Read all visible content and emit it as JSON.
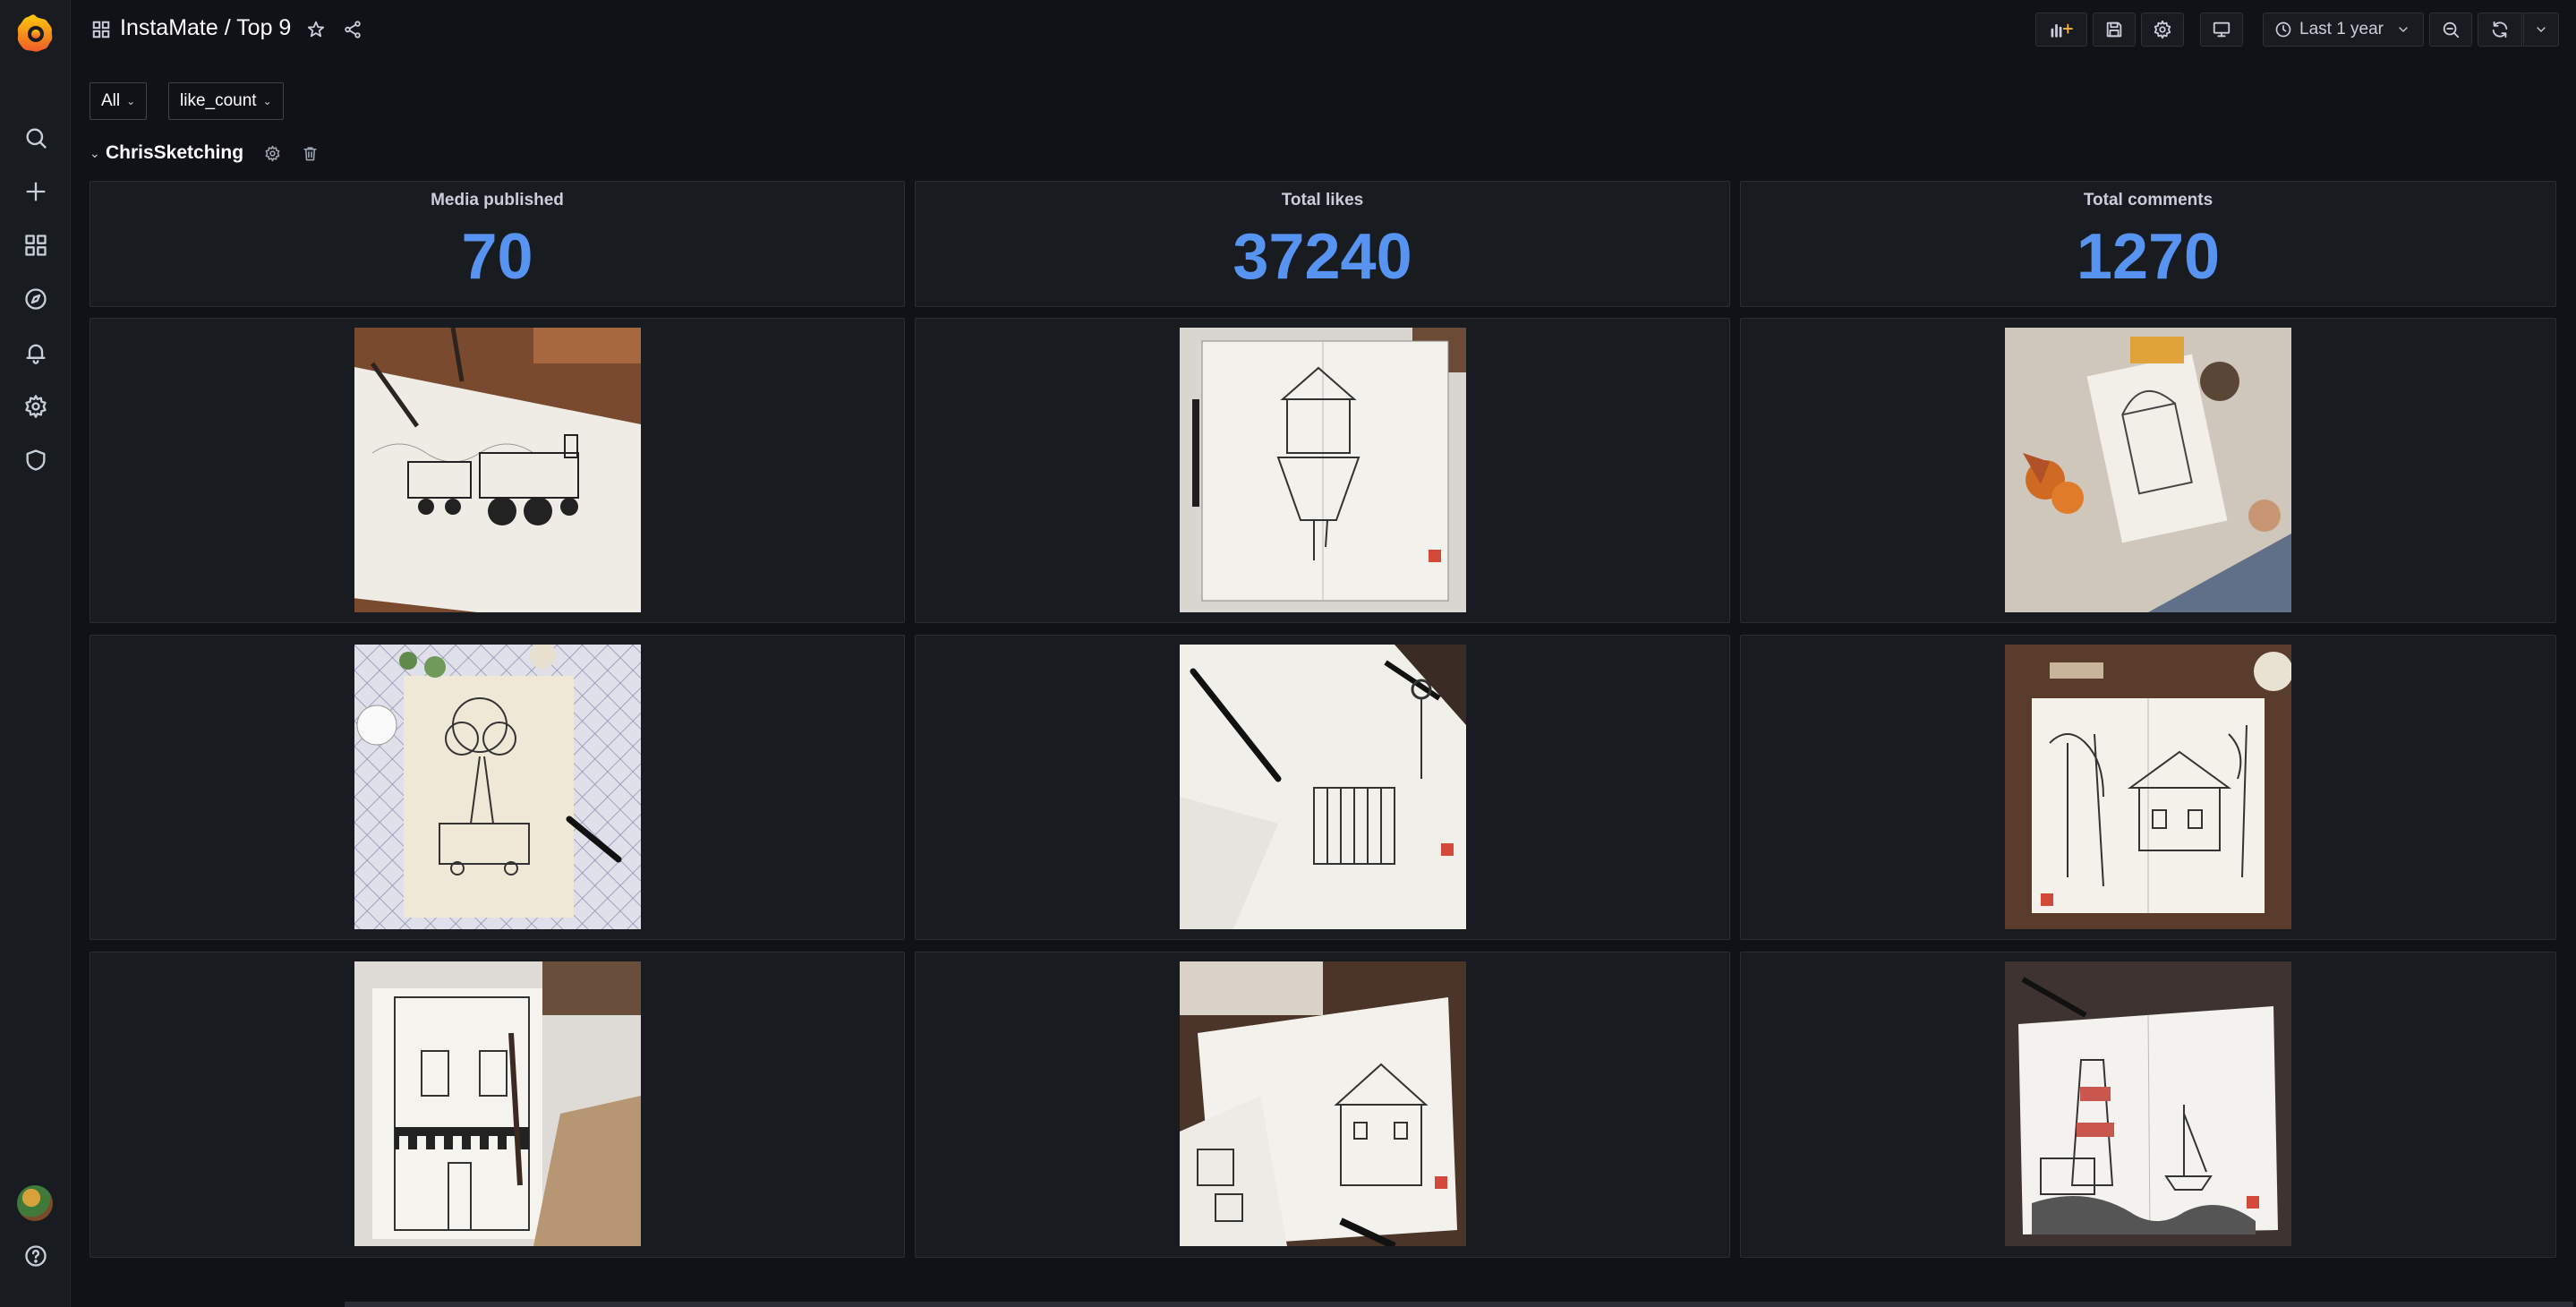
{
  "breadcrumb": {
    "folder": "InstaMate",
    "separator": " / ",
    "dashboard": "Top 9"
  },
  "toolbar": {
    "time_range": "Last 1 year"
  },
  "variables": [
    {
      "value": "All"
    },
    {
      "value": "like_count"
    }
  ],
  "row": {
    "title": "ChrisSketching"
  },
  "stats": [
    {
      "title": "Media published",
      "value": "70"
    },
    {
      "title": "Total likes",
      "value": "37240"
    },
    {
      "title": "Total comments",
      "value": "1270"
    }
  ],
  "posts": [
    {
      "icon": "sketch-train-image"
    },
    {
      "icon": "sketch-floating-house-image"
    },
    {
      "icon": "sketch-autumn-doorway-image"
    },
    {
      "icon": "sketch-balloon-bus-image"
    },
    {
      "icon": "sketch-fence-image"
    },
    {
      "icon": "sketch-forest-house-image"
    },
    {
      "icon": "sketch-laundromat-storefront-image"
    },
    {
      "icon": "sketch-mansion-notebook-image"
    },
    {
      "icon": "sketch-lighthouse-image"
    }
  ],
  "colors": {
    "stat_value": "#5794f2",
    "background": "#111217",
    "panel": "#181b1f"
  }
}
